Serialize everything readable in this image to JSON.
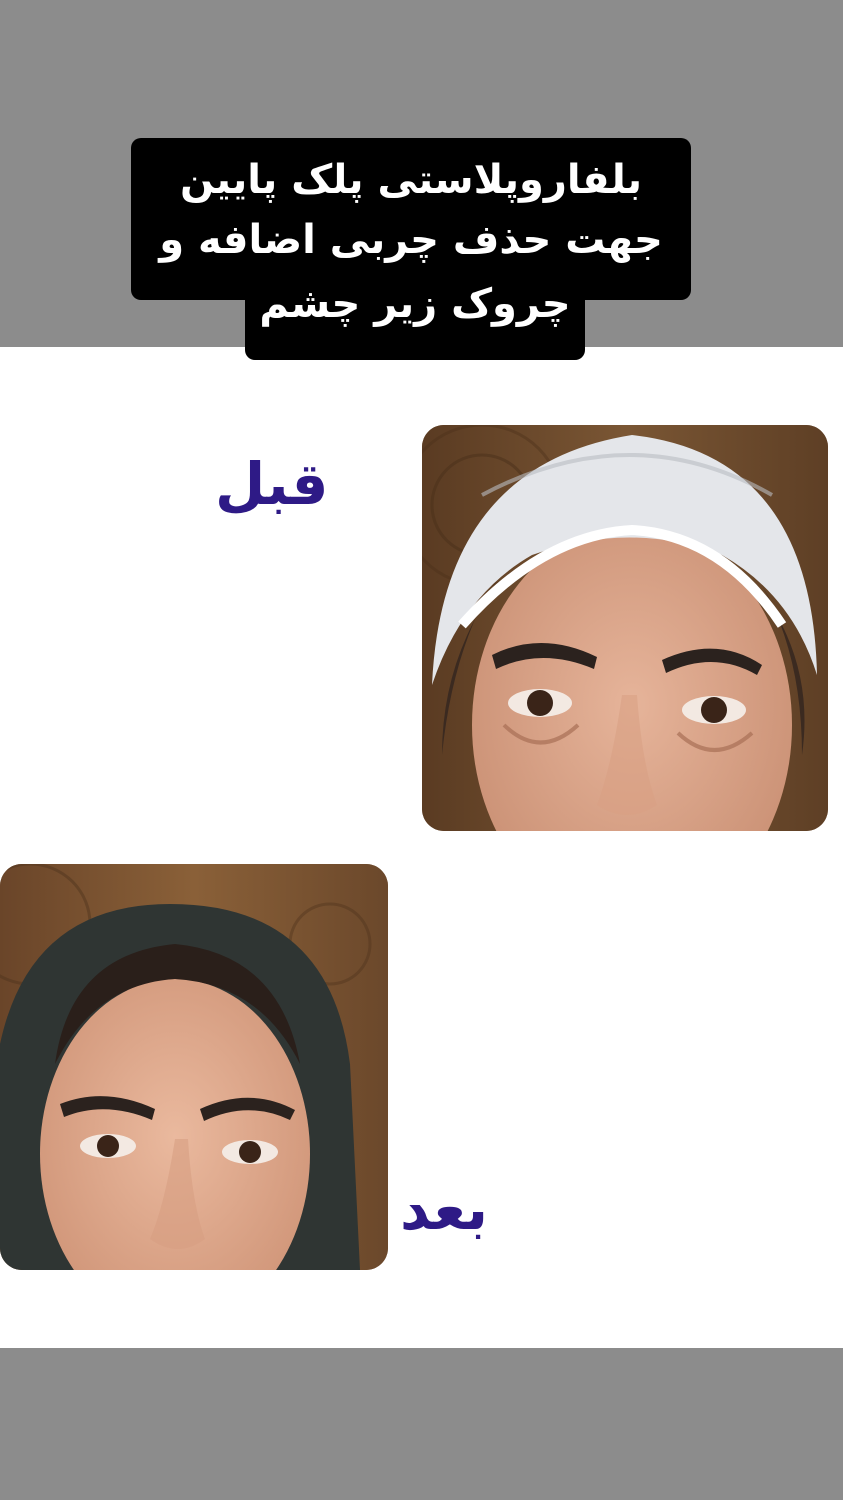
{
  "title": {
    "line1": "بلفاروپلاستی پلک پایین",
    "line2": "جهت حذف چربی اضافه و",
    "line3": "چروک زیر چشم"
  },
  "labels": {
    "before": "قبل",
    "after": "بعد"
  },
  "colors": {
    "band": "#8c8c8c",
    "title_bg": "#000000",
    "title_text": "#ffffff",
    "label_text": "#2e1a86",
    "background": "#ffffff"
  }
}
